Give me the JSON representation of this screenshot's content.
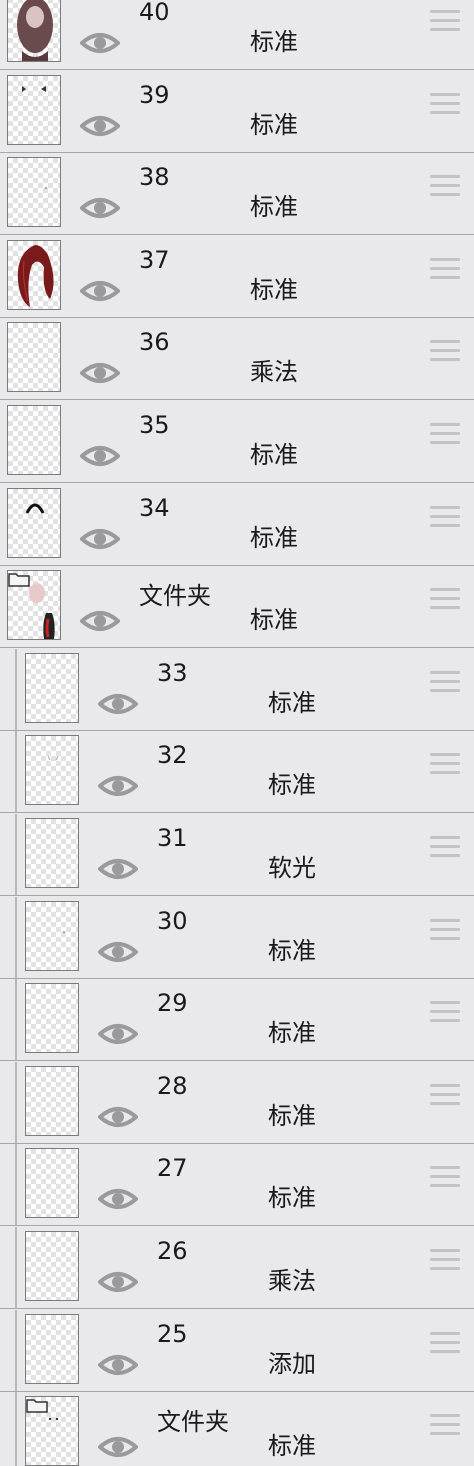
{
  "layers_panel": {
    "layers": [
      {
        "name": "40",
        "blend": "标准",
        "indent": false,
        "is_folder": false,
        "thumb": "figure"
      },
      {
        "name": "39",
        "blend": "标准",
        "indent": false,
        "is_folder": false,
        "thumb": "eyes"
      },
      {
        "name": "38",
        "blend": "标准",
        "indent": false,
        "is_folder": false,
        "thumb": "dot"
      },
      {
        "name": "37",
        "blend": "标准",
        "indent": false,
        "is_folder": false,
        "thumb": "hair"
      },
      {
        "name": "36",
        "blend": "乘法",
        "indent": false,
        "is_folder": false,
        "thumb": "empty"
      },
      {
        "name": "35",
        "blend": "标准",
        "indent": false,
        "is_folder": false,
        "thumb": "empty"
      },
      {
        "name": "34",
        "blend": "标准",
        "indent": false,
        "is_folder": false,
        "thumb": "arc"
      },
      {
        "name": "文件夹",
        "blend": "标准",
        "indent": false,
        "is_folder": true,
        "thumb": "folder-figure"
      },
      {
        "name": "33",
        "blend": "标准",
        "indent": true,
        "is_folder": false,
        "thumb": "empty"
      },
      {
        "name": "32",
        "blend": "标准",
        "indent": true,
        "is_folder": false,
        "thumb": "faint"
      },
      {
        "name": "31",
        "blend": "软光",
        "indent": true,
        "is_folder": false,
        "thumb": "empty"
      },
      {
        "name": "30",
        "blend": "标准",
        "indent": true,
        "is_folder": false,
        "thumb": "dot"
      },
      {
        "name": "29",
        "blend": "标准",
        "indent": true,
        "is_folder": false,
        "thumb": "empty"
      },
      {
        "name": "28",
        "blend": "标准",
        "indent": true,
        "is_folder": false,
        "thumb": "empty"
      },
      {
        "name": "27",
        "blend": "标准",
        "indent": true,
        "is_folder": false,
        "thumb": "empty"
      },
      {
        "name": "26",
        "blend": "乘法",
        "indent": true,
        "is_folder": false,
        "thumb": "empty"
      },
      {
        "name": "25",
        "blend": "添加",
        "indent": true,
        "is_folder": false,
        "thumb": "empty"
      },
      {
        "name": "文件夹",
        "blend": "标准",
        "indent": true,
        "is_folder": true,
        "thumb": "folder-eyes"
      }
    ]
  },
  "colors": {
    "panel_bg": "#e9e8ea",
    "divider": "#a7a6a9",
    "eye_icon": "#9a999c",
    "handle": "#c3c2c5",
    "text": "#1a1a1a"
  }
}
